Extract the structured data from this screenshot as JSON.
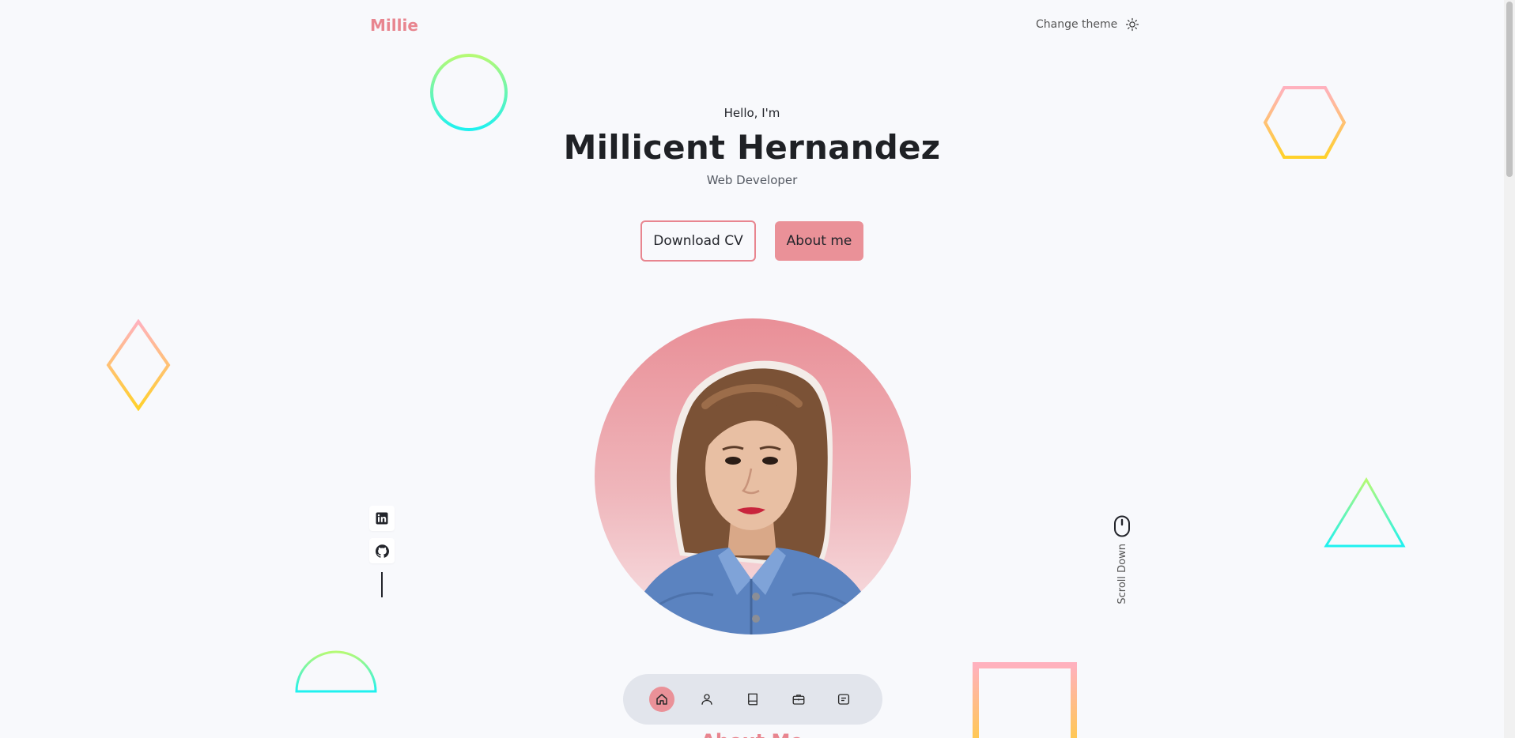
{
  "header": {
    "logo": "Millie",
    "theme_toggle_label": "Change theme"
  },
  "hero": {
    "greeting": "Hello, I'm",
    "name": "Millicent Hernandez",
    "role": "Web Developer",
    "download_cv_label": "Download CV",
    "about_me_label": "About me",
    "scroll_down_label": "Scroll Down"
  },
  "socials": [
    "linkedin-icon",
    "github-icon"
  ],
  "bottom_nav": {
    "items": [
      "home-icon",
      "user-icon",
      "book-icon",
      "briefcase-icon",
      "message-icon"
    ],
    "active": "home-icon"
  },
  "next_section_peek": "About Me",
  "colors": {
    "accent": "#e8858f",
    "button_fill": "#ea9198",
    "background": "#f8f9fc",
    "nav_bg": "#e2e5ec",
    "text_dark": "#1f2125"
  }
}
